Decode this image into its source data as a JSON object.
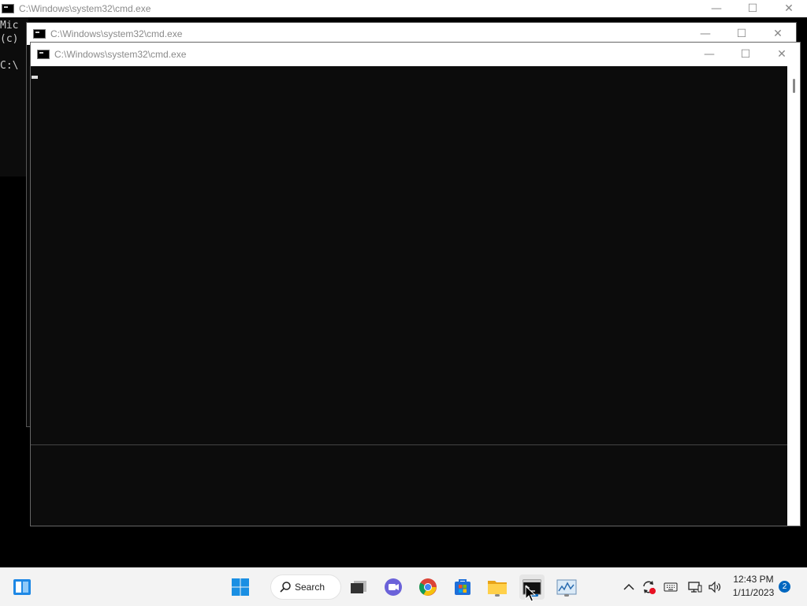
{
  "background_window": {
    "title": "C:\\Windows\\system32\\cmd.exe",
    "console_lines": [
      "Mic",
      "(c)",
      "",
      "C:\\"
    ]
  },
  "middle_window": {
    "title": "C:\\Windows\\system32\\cmd.exe"
  },
  "front_window": {
    "title": "C:\\Windows\\system32\\cmd.exe",
    "cursor": "_"
  },
  "window_controls": {
    "minimize": "—",
    "maximize": "☐",
    "close": "✕"
  },
  "taskbar": {
    "search_label": "Search",
    "clock_time": "12:43 PM",
    "clock_date": "1/11/2023",
    "notification_count": "2",
    "icons": [
      "widgets-icon",
      "start-icon",
      "search-icon",
      "task-view-icon",
      "chat-icon",
      "chrome-icon",
      "store-icon",
      "file-explorer-icon",
      "terminal-icon",
      "resource-monitor-icon"
    ],
    "tray_icons": [
      "chevron-up-icon",
      "sync-icon",
      "keyboard-icon",
      "network-icon",
      "volume-icon"
    ]
  }
}
